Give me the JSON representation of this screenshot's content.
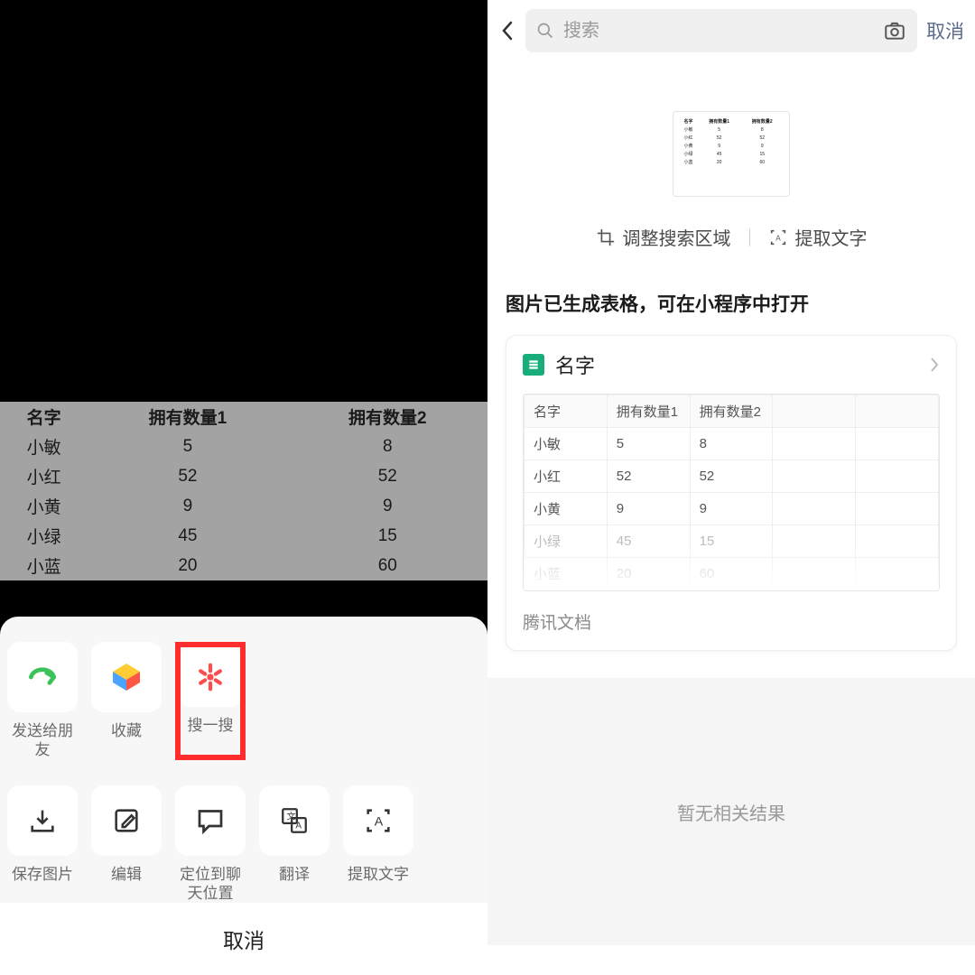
{
  "left": {
    "table": {
      "headers": [
        "名字",
        "拥有数量1",
        "拥有数量2"
      ],
      "rows": [
        [
          "小敏",
          "5",
          "8"
        ],
        [
          "小红",
          "52",
          "52"
        ],
        [
          "小黄",
          "9",
          "9"
        ],
        [
          "小绿",
          "45",
          "15"
        ],
        [
          "小蓝",
          "20",
          "60"
        ]
      ]
    },
    "actions_row1": [
      {
        "label": "发送给朋友"
      },
      {
        "label": "收藏"
      },
      {
        "label": "搜一搜"
      }
    ],
    "actions_row2": [
      {
        "label": "保存图片"
      },
      {
        "label": "编辑"
      },
      {
        "label": "定位到聊天位置"
      },
      {
        "label": "翻译"
      },
      {
        "label": "提取文字"
      }
    ],
    "cancel": "取消"
  },
  "right": {
    "search_placeholder": "搜索",
    "cancel": "取消",
    "tool_crop": "调整搜索区域",
    "tool_ocr": "提取文字",
    "result_title": "图片已生成表格，可在小程序中打开",
    "doc_name": "名字",
    "doc_table": {
      "headers": [
        "名字",
        "拥有数量1",
        "拥有数量2",
        "",
        ""
      ],
      "rows": [
        [
          "小敏",
          "5",
          "8",
          "",
          ""
        ],
        [
          "小红",
          "52",
          "52",
          "",
          ""
        ],
        [
          "小黄",
          "9",
          "9",
          "",
          ""
        ],
        [
          "小绿",
          "45",
          "15",
          "",
          ""
        ],
        [
          "小蓝",
          "20",
          "60",
          "",
          ""
        ]
      ]
    },
    "doc_source": "腾讯文档",
    "no_result": "暂无相关结果"
  },
  "chart_data": {
    "type": "table",
    "title": "",
    "columns": [
      "名字",
      "拥有数量1",
      "拥有数量2"
    ],
    "rows": [
      {
        "名字": "小敏",
        "拥有数量1": 5,
        "拥有数量2": 8
      },
      {
        "名字": "小红",
        "拥有数量1": 52,
        "拥有数量2": 52
      },
      {
        "名字": "小黄",
        "拥有数量1": 9,
        "拥有数量2": 9
      },
      {
        "名字": "小绿",
        "拥有数量1": 45,
        "拥有数量2": 15
      },
      {
        "名字": "小蓝",
        "拥有数量1": 20,
        "拥有数量2": 60
      }
    ]
  }
}
